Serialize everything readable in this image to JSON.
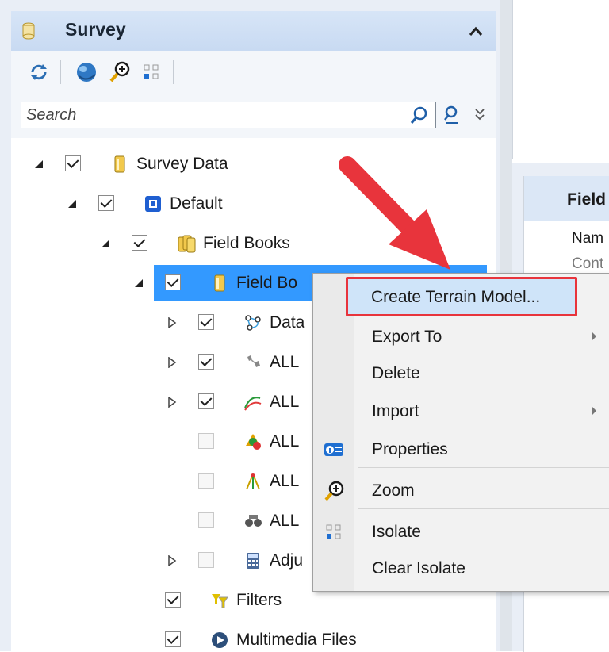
{
  "panel": {
    "title": "Survey",
    "search_placeholder": "Search"
  },
  "tree": [
    {
      "label": "Survey Data",
      "checked": true,
      "expanded": true,
      "icon": "survey-data-icon"
    },
    {
      "label": "Default",
      "checked": true,
      "expanded": true,
      "icon": "default-project-icon"
    },
    {
      "label": "Field Books",
      "checked": true,
      "expanded": true,
      "icon": "field-books-icon"
    },
    {
      "label": "Field Bo",
      "checked": true,
      "expanded": true,
      "icon": "field-book-icon",
      "selected": true
    },
    {
      "label": "Data",
      "checked": true,
      "expanded": false,
      "icon": "data-icon"
    },
    {
      "label": "ALL",
      "checked": true,
      "expanded": false,
      "icon": "points-icon"
    },
    {
      "label": "ALL",
      "checked": true,
      "expanded": false,
      "icon": "linear-features-icon"
    },
    {
      "label": "ALL",
      "checked": false,
      "expanded": null,
      "icon": "control-icon"
    },
    {
      "label": "ALL",
      "checked": false,
      "expanded": null,
      "icon": "setups-icon"
    },
    {
      "label": "ALL",
      "checked": false,
      "expanded": null,
      "icon": "observations-icon"
    },
    {
      "label": "Adju",
      "checked": false,
      "expanded": false,
      "icon": "adjustment-icon"
    },
    {
      "label": "Filters",
      "checked": true,
      "expanded": null,
      "icon": "filters-icon"
    },
    {
      "label": "Multimedia Files",
      "checked": true,
      "expanded": null,
      "icon": "multimedia-icon"
    }
  ],
  "context_menu": {
    "items": [
      {
        "label": "Create Terrain Model...",
        "submenu": false,
        "icon": "",
        "highlighted": true
      },
      {
        "label": "Export To",
        "submenu": true,
        "icon": ""
      },
      {
        "label": "Delete",
        "submenu": false,
        "icon": ""
      },
      {
        "label": "Import",
        "submenu": true,
        "icon": ""
      },
      {
        "label": "Properties",
        "submenu": false,
        "icon": "properties-icon"
      },
      {
        "label": "Zoom",
        "submenu": false,
        "icon": "zoom-icon"
      },
      {
        "label": "Isolate",
        "submenu": false,
        "icon": "isolate-icon"
      },
      {
        "label": "Clear Isolate",
        "submenu": false,
        "icon": ""
      }
    ]
  },
  "properties_panel": {
    "title": "Field",
    "row1": "Nam",
    "row2": "Cont"
  },
  "colors": {
    "selection": "#3399ff",
    "annotation": "#e8343c",
    "header": "#c8daf2"
  }
}
